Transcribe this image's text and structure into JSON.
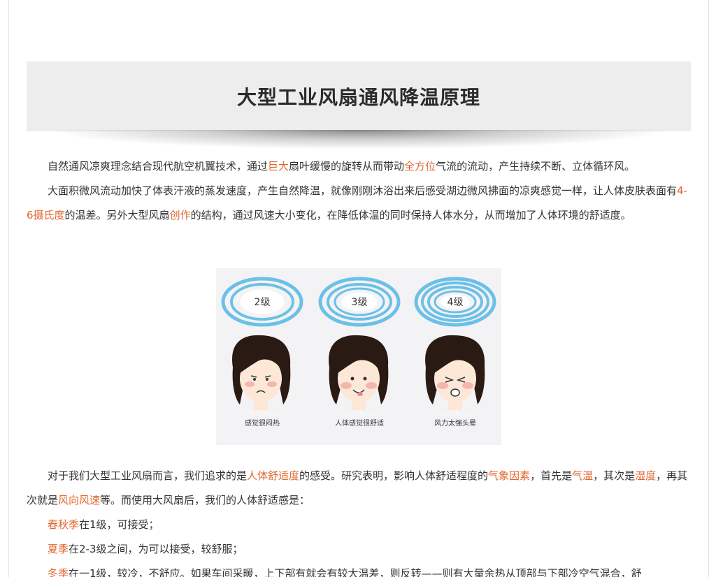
{
  "article": {
    "title": "大型工业风扇通风降温原理",
    "para1": {
      "t1": "自然通风凉爽理念结合现代航空机翼技术，通过",
      "h1": "巨大",
      "t2": "扇叶缓慢的旋转从而带动",
      "h2": "全方位",
      "t3": "气流的流动，产生持续不断、立体循环风。"
    },
    "para2": {
      "t1": "大面积微风流动加快了体表汗液的蒸发速度，产生自然降温，就像刚刚沐浴出来后感受湖边微风拂面的凉爽感觉一样，让人体皮肤表面有",
      "h1": "4-6摄氏度",
      "t2": "的温差。另外大型风扇",
      "h2": "创作",
      "t3": "的结构，通过风速大小变化，在降低体温的同时保持人体水分，从而增加了人体环境的舒适度。"
    },
    "figure": {
      "levels": [
        "2级",
        "3级",
        "4级"
      ],
      "captions": [
        "感觉很闷热",
        "人体感觉很舒适",
        "风力太强头晕"
      ]
    },
    "para3": {
      "t1": "对于我们大型工业风扇而言，我们追求的是",
      "h1": "人体舒适度",
      "t2": "的感受。研究表明，影响人体舒适程度的",
      "h2": "气象因素",
      "t3": "，首先是",
      "h3": "气温",
      "t4": "，其次是",
      "h4": "湿度",
      "t5": "，再其次就是",
      "h5": "风向风速",
      "t6": "等。而使用大风扇后，我们的人体舒适感是："
    },
    "list": [
      {
        "season": "春秋季",
        "text": "在1级，可接受；"
      },
      {
        "season": "夏季",
        "text": "在2-3级之间，为可以接受，较舒服；"
      },
      {
        "season": "冬季",
        "text": "在一1级，较冷，不舒应。如果车间采暖，上下部有就会有较大温差，则反转——则有大量余热从顶部与下部冷空气混合，舒"
      }
    ]
  },
  "colors": {
    "highlight": "#e2672f",
    "ring": "#6cc0e8",
    "banner": "#ededed"
  }
}
